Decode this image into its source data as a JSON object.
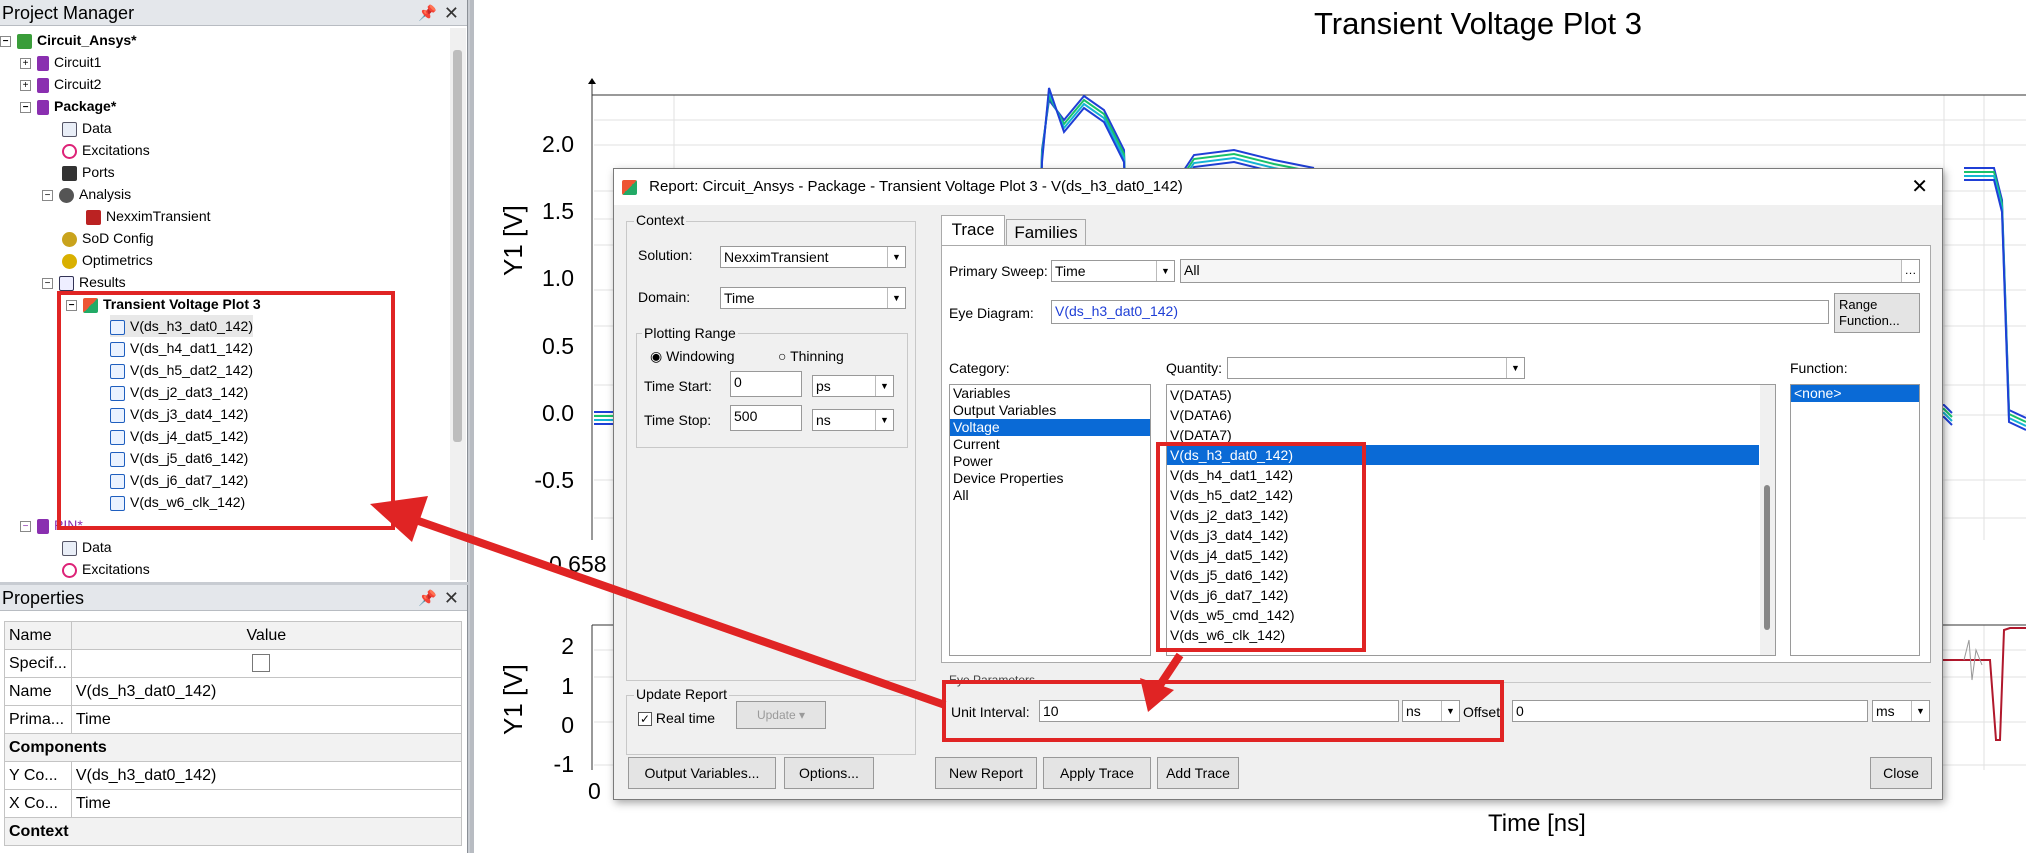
{
  "project_manager": {
    "title": "Project Manager",
    "root": "Circuit_Ansys*",
    "items": [
      "Circuit1",
      "Circuit2",
      "Package*",
      "Data",
      "Excitations",
      "Ports",
      "Analysis",
      "NexximTransient",
      "SoD Config",
      "Optimetrics",
      "Results",
      "Transient Voltage Plot 3"
    ],
    "traces": [
      "V(ds_h3_dat0_142)",
      "V(ds_h4_dat1_142)",
      "V(ds_h5_dat2_142)",
      "V(ds_j2_dat3_142)",
      "V(ds_j3_dat4_142)",
      "V(ds_j4_dat5_142)",
      "V(ds_j5_dat6_142)",
      "V(ds_j6_dat7_142)",
      "V(ds_w6_clk_142)"
    ],
    "after": [
      "PIN*",
      "Data",
      "Excitations"
    ]
  },
  "properties": {
    "title": "Properties",
    "col_name": "Name",
    "col_value": "Value",
    "rows": [
      {
        "name": "Specif...",
        "value": ""
      },
      {
        "name": "Name",
        "value": "V(ds_h3_dat0_142)"
      },
      {
        "name": "Prima...",
        "value": "Time"
      },
      {
        "section": "Components"
      },
      {
        "name": "Y Co...",
        "value": "V(ds_h3_dat0_142)"
      },
      {
        "name": "X Co...",
        "value": "Time"
      },
      {
        "section": "Context"
      }
    ]
  },
  "plot": {
    "title": "Transient Voltage Plot 3",
    "ylabel": "Y1 [V]",
    "xlabel": "Time [ns]",
    "top_ticks": [
      "2.0",
      "1.5",
      "1.0",
      "0.5",
      "0.0",
      "-0.5"
    ],
    "partial_tick": "0.658",
    "bottom_ticks": [
      "2",
      "1",
      "0",
      "-1"
    ],
    "x_tick": "0"
  },
  "dialog": {
    "title": "Report: Circuit_Ansys - Package - Transient Voltage Plot 3 - V(ds_h3_dat0_142)",
    "context_label": "Context",
    "solution_label": "Solution:",
    "solution_value": "NexximTransient",
    "domain_label": "Domain:",
    "domain_value": "Time",
    "plotting_range_label": "Plotting Range",
    "windowing": "Windowing",
    "thinning": "Thinning",
    "time_start_label": "Time Start:",
    "time_start": "0",
    "time_start_unit": "ps",
    "time_stop_label": "Time Stop:",
    "time_stop": "500",
    "time_stop_unit": "ns",
    "update_report_label": "Update Report",
    "realtime": "Real time",
    "update_btn": "Update",
    "tab_trace": "Trace",
    "tab_families": "Families",
    "primary_sweep_label": "Primary Sweep:",
    "primary_sweep": "Time",
    "primary_sweep_all": "All",
    "eye_diagram_label": "Eye Diagram:",
    "eye_diagram_value": "V(ds_h3_dat0_142)",
    "range_function_btn": "Range Function...",
    "category_label": "Category:",
    "categories": [
      "Variables",
      "Output Variables",
      "Voltage",
      "Current",
      "Power",
      "Device Properties",
      "All"
    ],
    "quantity_label": "Quantity:",
    "quantities": [
      "V(DATA5)",
      "V(DATA6)",
      "V(DATA7)",
      "V(ds_h3_dat0_142)",
      "V(ds_h4_dat1_142)",
      "V(ds_h5_dat2_142)",
      "V(ds_j2_dat3_142)",
      "V(ds_j3_dat4_142)",
      "V(ds_j4_dat5_142)",
      "V(ds_j5_dat6_142)",
      "V(ds_j6_dat7_142)",
      "V(ds_w5_cmd_142)",
      "V(ds_w6_clk_142)"
    ],
    "function_label": "Function:",
    "function_value": "<none>",
    "eye_params_label": "Eye Parameters",
    "unit_interval_label": "Unit Interval:",
    "unit_interval": "10",
    "unit_interval_unit": "ns",
    "offset_label": "Offset:",
    "offset": "0",
    "offset_unit": "ms",
    "btn_output_vars": "Output Variables...",
    "btn_options": "Options...",
    "btn_new_report": "New Report",
    "btn_apply": "Apply Trace",
    "btn_add": "Add Trace",
    "btn_close": "Close"
  },
  "colors": {
    "accent": "#0a6ad6",
    "annotation": "#e02424",
    "trace_blue": "#1f3fd6",
    "trace_green": "#19c26a",
    "trace_cyan": "#15b4d4"
  }
}
